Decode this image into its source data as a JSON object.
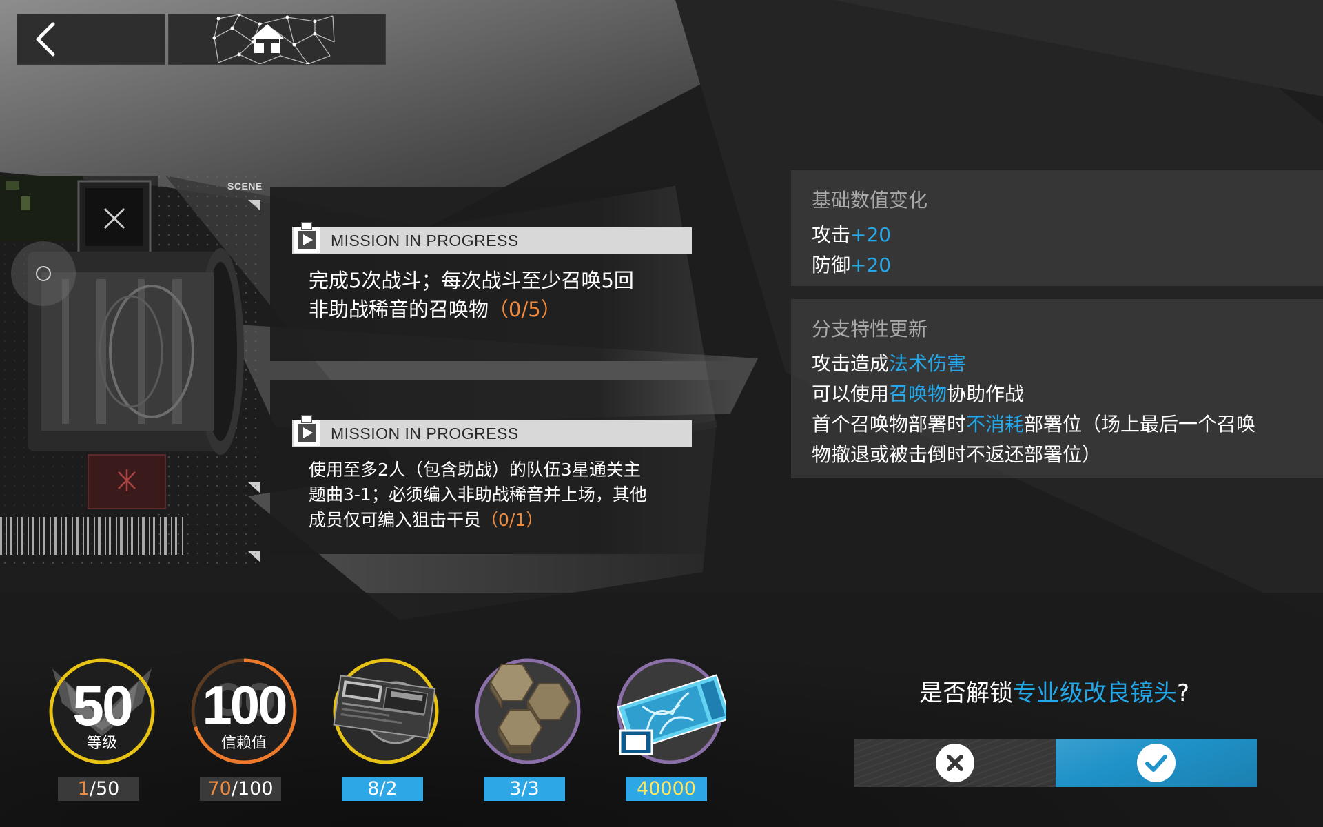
{
  "nav": {
    "back_icon": "chevron-left-icon",
    "home_icon": "home-icon"
  },
  "scene": {
    "label": "SCENE"
  },
  "missions": [
    {
      "header": "MISSION IN PROGRESS",
      "icon": "clipboard-play-icon",
      "line1": "完成5次战斗；每次战斗至少召唤5回",
      "line2_text": "非助战稀音的召唤物",
      "progress": "（0/5）"
    },
    {
      "header": "MISSION IN PROGRESS",
      "icon": "clipboard-play-icon",
      "line1": "使用至多2人（包含助战）的队伍3星通关主",
      "line2": "题曲3-1；必须编入非助战稀音并上场，其他",
      "line3_text": "成员仅可编入狙击干员",
      "progress": "（0/1）"
    }
  ],
  "stats_panel": {
    "title": "基础数值变化",
    "lines": [
      {
        "label": "攻击",
        "value": "+20"
      },
      {
        "label": "防御",
        "value": "+20"
      }
    ]
  },
  "trait_panel": {
    "title": "分支特性更新",
    "line1_pre": "攻击造成",
    "line1_hl": "法术伤害",
    "line2_pre": "可以使用",
    "line2_hl": "召唤物",
    "line2_post": "协助作战",
    "line3_pre": "首个召唤物部署时",
    "line3_hl": "不消耗",
    "line3_post": "部署位（场上最后一个召唤",
    "line4": "物撤退或被击倒时不返还部署位）"
  },
  "rewards": [
    {
      "name": "level",
      "big": "50",
      "label": "等级",
      "count_hl": "1",
      "count_rest": "/50",
      "ring_color": "#e8c316",
      "ring_fill": 0.02
    },
    {
      "name": "trust",
      "big": "100",
      "label": "信赖值",
      "count_hl": "70",
      "count_rest": "/100",
      "ring_color": "#ec7a2a",
      "ring_fill": 0.7
    },
    {
      "name": "module-data-chip",
      "count": "8/2",
      "ring_color": "#e8c316"
    },
    {
      "name": "carbon-material",
      "count": "3/3",
      "ring_color": "#8a6fa8"
    },
    {
      "name": "lmd-ticket",
      "count": "40000",
      "ring_color": "#8a6fa8"
    }
  ],
  "prompt": {
    "pre": "是否解锁",
    "highlight": "专业级改良镜头",
    "post": "?"
  },
  "buttons": {
    "cancel_icon": "close-icon",
    "confirm_icon": "check-icon"
  },
  "colors": {
    "accent_blue": "#24a7e8",
    "progress_orange": "#f08a3c",
    "level_gold": "#e8c316"
  }
}
